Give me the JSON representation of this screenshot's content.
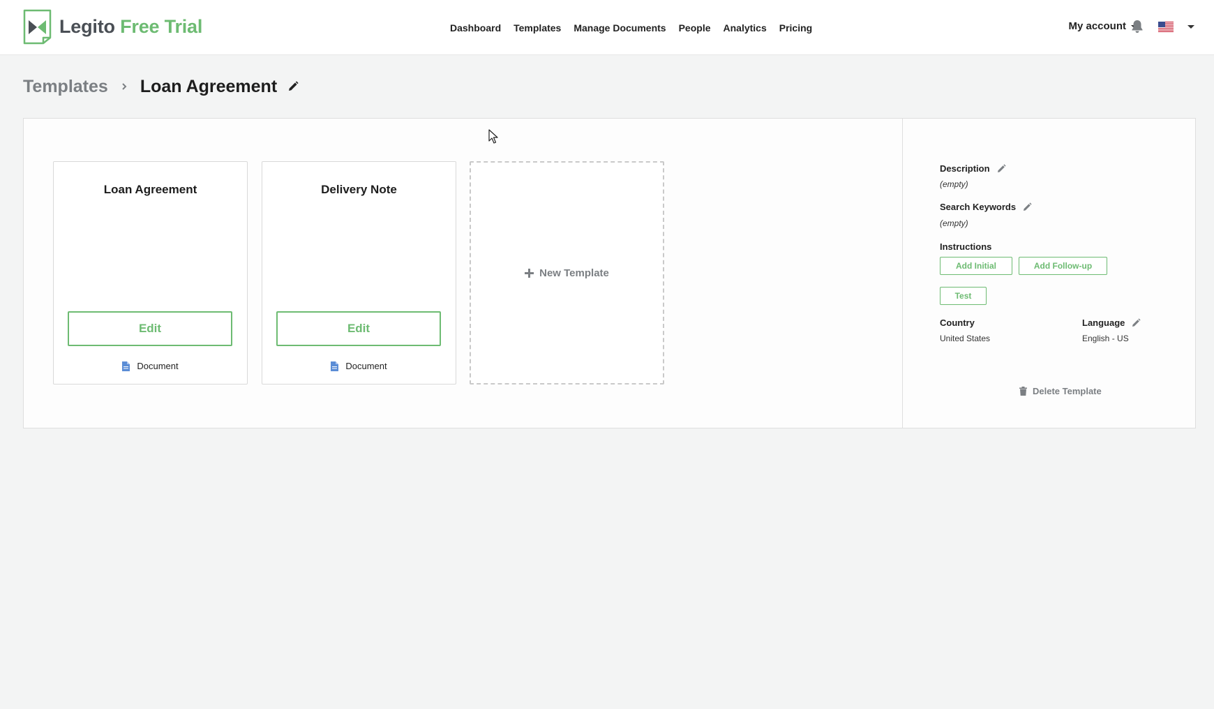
{
  "header": {
    "logo_brand": "Legito",
    "logo_trial": "Free Trial",
    "nav": [
      "Dashboard",
      "Templates",
      "Manage Documents",
      "People",
      "Analytics",
      "Pricing"
    ],
    "account_label": "My account",
    "icons": [
      "bell-icon",
      "us-flag-icon",
      "chevron-down-icon"
    ]
  },
  "breadcrumb": {
    "parent": "Templates",
    "current": "Loan Agreement"
  },
  "cards": [
    {
      "title": "Loan Agreement",
      "edit_label": "Edit",
      "type_label": "Document"
    },
    {
      "title": "Delivery Note",
      "edit_label": "Edit",
      "type_label": "Document"
    }
  ],
  "new_template_label": "New Template",
  "details": {
    "description_label": "Description",
    "description_value": "(empty)",
    "keywords_label": "Search Keywords",
    "keywords_value": "(empty)",
    "instructions_label": "Instructions",
    "add_initial_label": "Add Initial",
    "add_followup_label": "Add Follow-up",
    "test_label": "Test",
    "country_label": "Country",
    "country_value": "United States",
    "language_label": "Language",
    "language_value": "English - US",
    "delete_label": "Delete Template"
  },
  "colors": {
    "accent": "#6dbb72",
    "background": "#f3f4f4",
    "muted": "#7b7f83"
  }
}
